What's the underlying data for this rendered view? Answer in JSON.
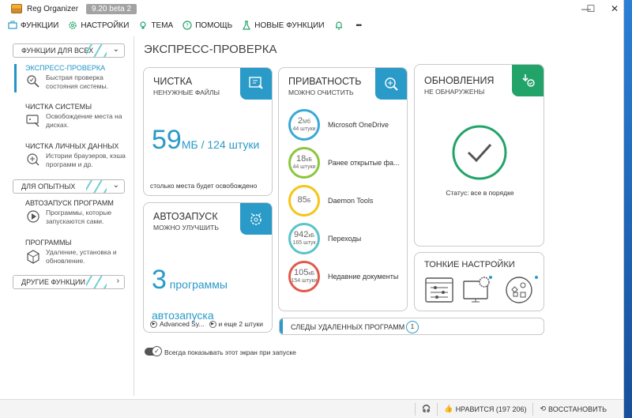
{
  "app": {
    "title": "Reg Organizer",
    "version": "9.20 beta 2"
  },
  "window_controls": {
    "minimize": "—",
    "maximize": "☐",
    "close": "✕"
  },
  "menu": [
    {
      "label": "ФУНКЦИИ",
      "icon": "toolbox-icon"
    },
    {
      "label": "НАСТРОЙКИ",
      "icon": "gear-icon"
    },
    {
      "label": "ТЕМА",
      "icon": "lightbulb-icon"
    },
    {
      "label": "ПОМОЩЬ",
      "icon": "help-circle-icon"
    },
    {
      "label": "НОВЫЕ ФУНКЦИИ",
      "icon": "flask-icon"
    },
    {
      "label": "",
      "icon": "bell-icon"
    },
    {
      "label": "•••",
      "icon": "more-icon"
    }
  ],
  "sidebar": {
    "section_all": "ФУНКЦИИ ДЛЯ ВСЕХ",
    "section_advanced": "ДЛЯ ОПЫТНЫХ",
    "section_other": "ДРУГИЕ ФУНКЦИИ",
    "items": [
      {
        "title": "ЭКСПРЕСС-ПРОВЕРКА",
        "desc": "Быстрая проверка состояния системы."
      },
      {
        "title": "ЧИСТКА СИСТЕМЫ",
        "desc": "Освобождение места на дисках."
      },
      {
        "title": "ЧИСТКА ЛИЧНЫХ ДАННЫХ",
        "desc": "Истории браузеров, кэша программ и др."
      },
      {
        "title": "АВТОЗАПУСК ПРОГРАММ",
        "desc": "Программы, которые запускаются сами."
      },
      {
        "title": "ПРОГРАММЫ",
        "desc": "Удаление, установка и обновление."
      }
    ]
  },
  "main": {
    "title": "ЭКСПРЕСС-ПРОВЕРКА",
    "cleanup": {
      "title": "ЧИСТКА",
      "sub": "НЕНУЖНЫЕ ФАЙЛЫ",
      "value": "59",
      "unit": "МБ / 124 штуки",
      "note": "столько места будет освобождено"
    },
    "autorun": {
      "title": "АВТОЗАПУСК",
      "sub": "МОЖНО УЛУЧШИТЬ",
      "value": "3",
      "unit": " программы автозапуска",
      "item1": "Advanced Sy...",
      "item2": "и еще 2 штуки"
    },
    "privacy": {
      "title": "ПРИВАТНОСТЬ",
      "sub": "МОЖНО ОЧИСТИТЬ",
      "rows": [
        {
          "value": "2",
          "unit": "Мб",
          "count": "44 штуки",
          "name": "Microsoft OneDrive",
          "color": "#3aa8d8"
        },
        {
          "value": "18",
          "unit": "кБ",
          "count": "44 штуки",
          "name": "Ранее открытые фа...",
          "color": "#8cc63f"
        },
        {
          "value": "85",
          "unit": "Б",
          "count": "",
          "name": "Daemon Tools",
          "color": "#f5c518"
        },
        {
          "value": "942",
          "unit": "кБ",
          "count": "165 штук",
          "name": "Переходы",
          "color": "#5bc3c9"
        },
        {
          "value": "105",
          "unit": "кБ",
          "count": "154 штуки",
          "name": "Недавние документы",
          "color": "#e05a4b"
        }
      ]
    },
    "updates": {
      "title": "ОБНОВЛЕНИЯ",
      "sub": "НЕ ОБНАРУЖЕНЫ",
      "status": "Статус: все в порядке"
    },
    "tweaks": {
      "title": "ТОНКИЕ НАСТРОЙКИ"
    },
    "removed_traces": {
      "label": "СЛЕДЫ УДАЛЕННЫХ ПРОГРАММ",
      "count": "1"
    },
    "startup_toggle": "Всегда показывать этот экран при запуске"
  },
  "statusbar": {
    "likes": "НРАВИТСЯ (197 206)",
    "restore": "ВОССТАНОВИТЬ"
  },
  "colors": {
    "accent": "#2a9ac8",
    "green": "#22a36a",
    "teal": "#4fc3c6"
  }
}
